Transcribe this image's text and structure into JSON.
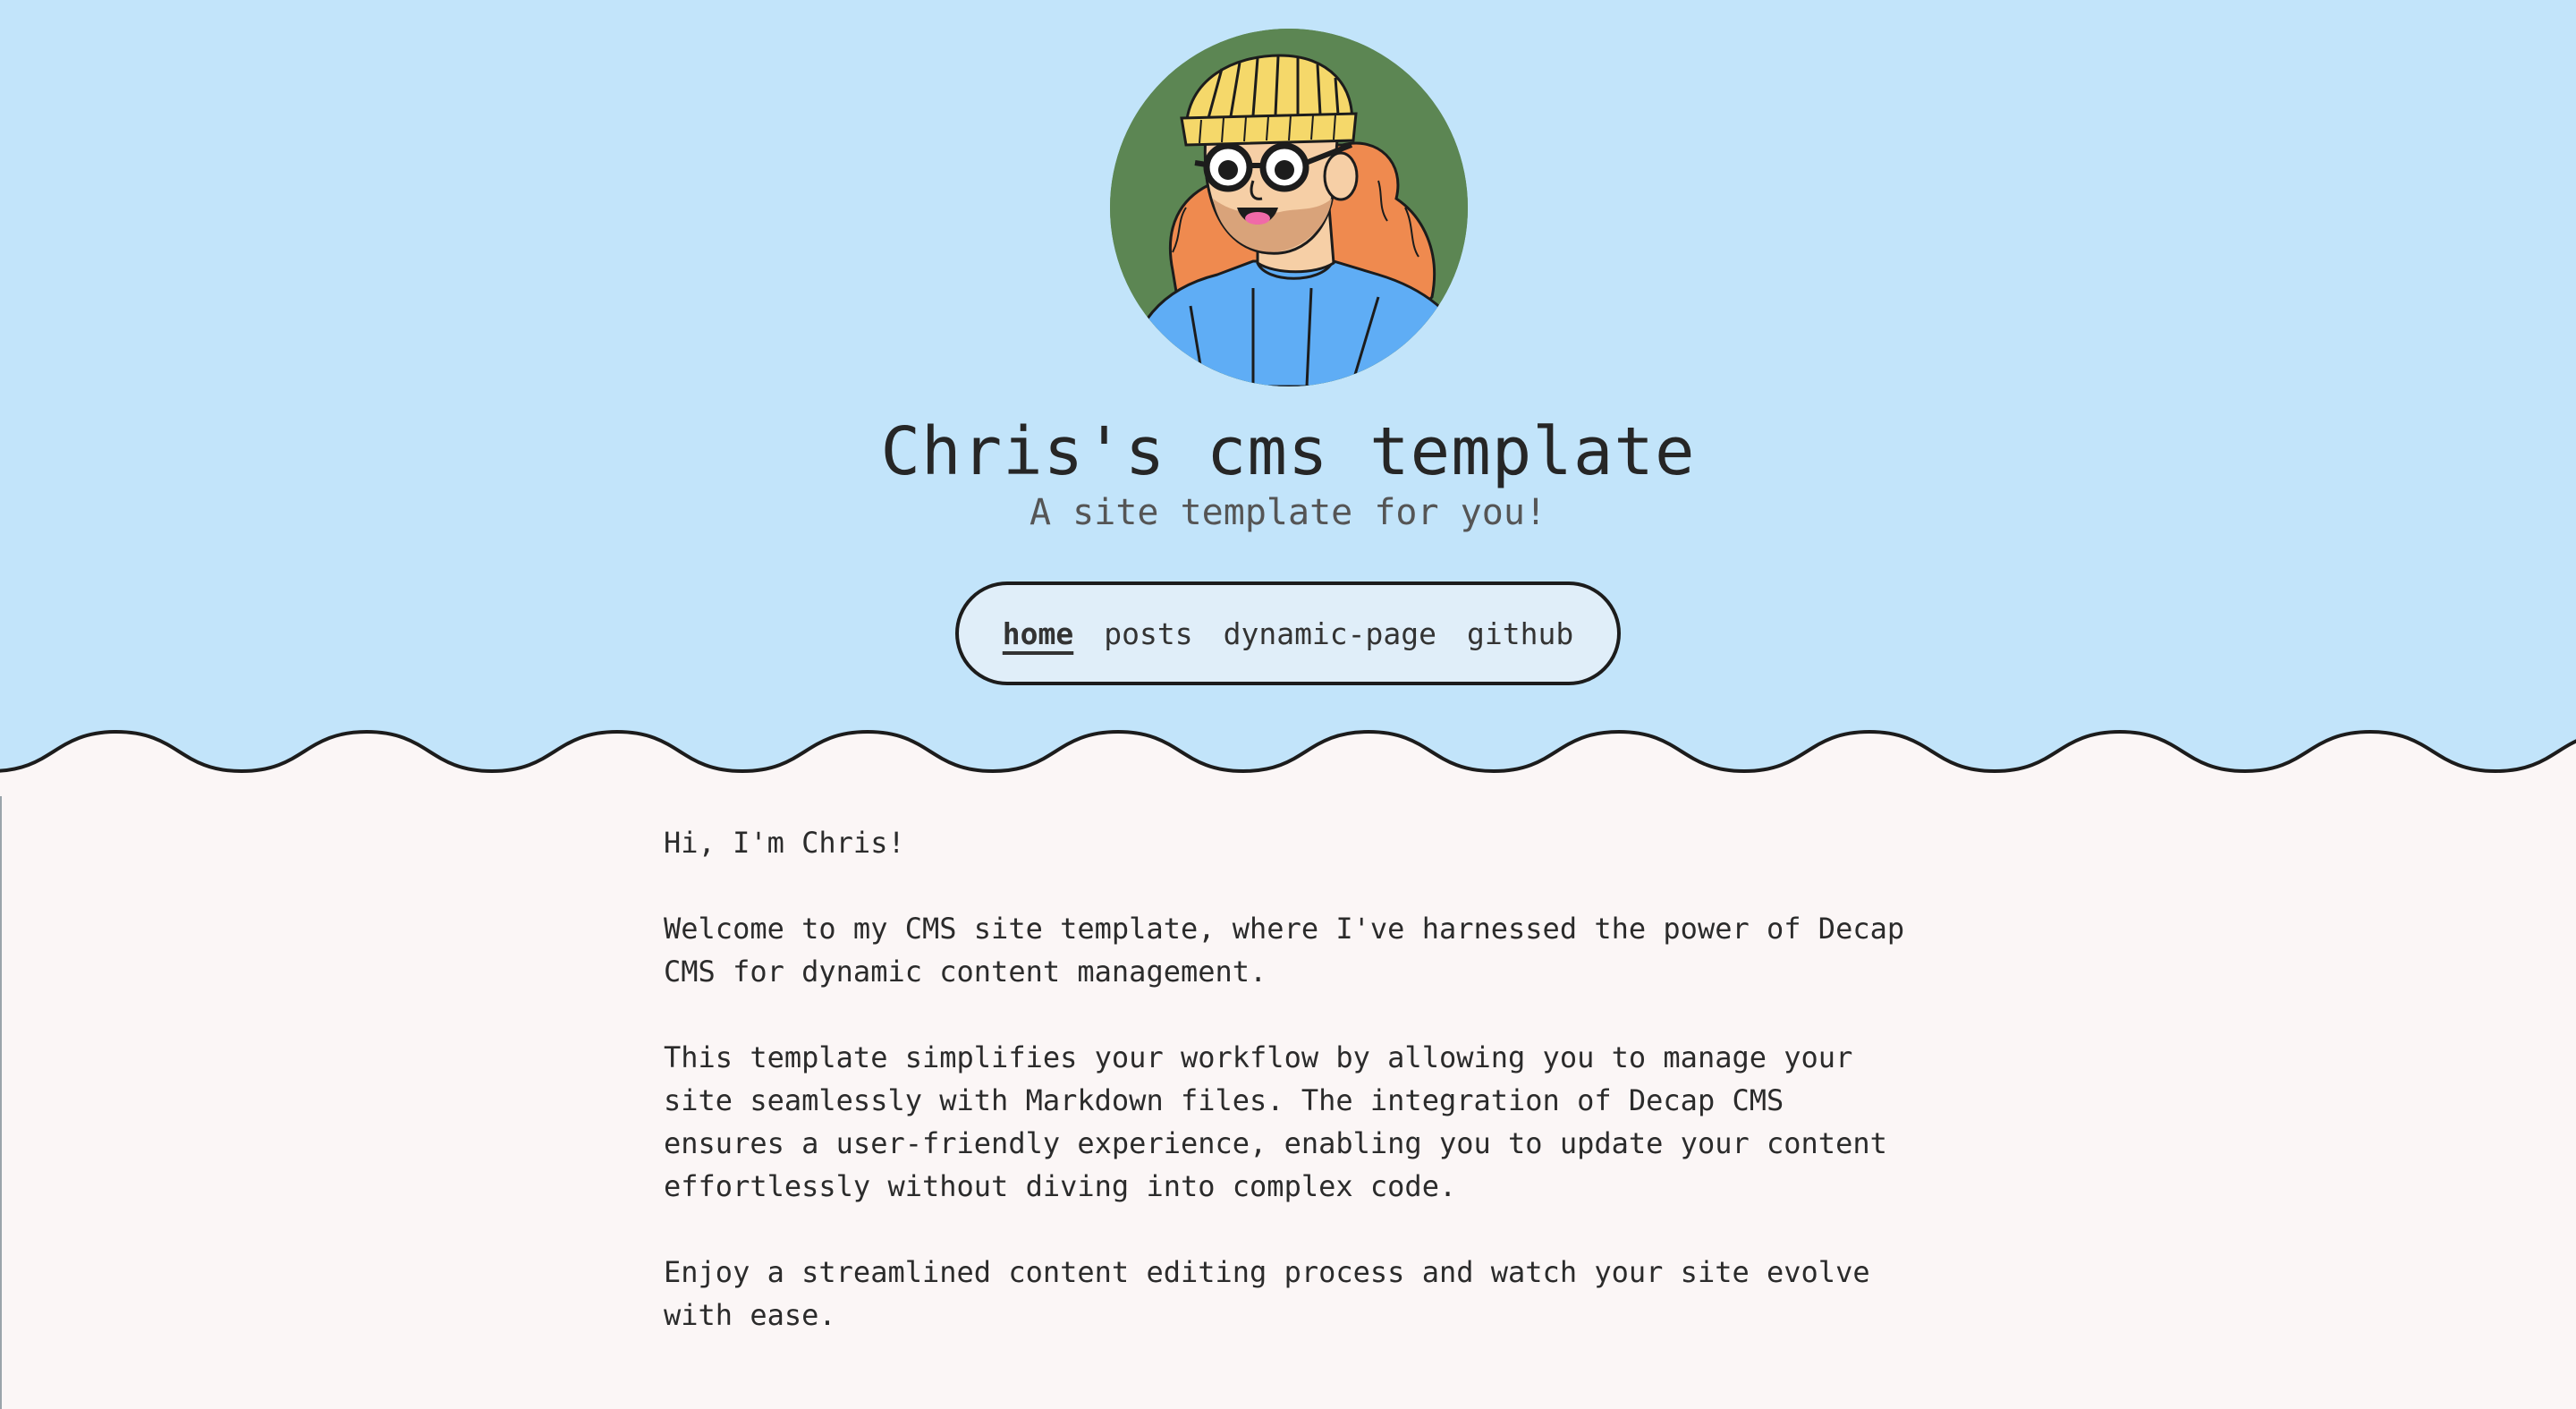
{
  "header": {
    "site_title": "Chris's cms template",
    "site_subtitle": "A site template for you!"
  },
  "avatar": {
    "icon": "avatar-illustration",
    "background": "#5c8653"
  },
  "nav": {
    "items": [
      {
        "label": "home",
        "active": true
      },
      {
        "label": "posts",
        "active": false
      },
      {
        "label": "dynamic-page",
        "active": false
      },
      {
        "label": "github",
        "active": false
      }
    ]
  },
  "content": {
    "paragraphs": [
      "Hi, I'm Chris!",
      "Welcome to my CMS site template, where I've harnessed the power of Decap CMS for dynamic content management.",
      "This template simplifies your workflow by allowing you to manage your site seamlessly with Markdown files. The integration of Decap CMS ensures a user-friendly experience, enabling you to update your content effortlessly without diving into complex code.",
      "Enjoy a streamlined content editing process and watch your site evolve with ease."
    ]
  },
  "colors": {
    "hero_background": "#c2e4fa",
    "page_background": "#fbf6f6",
    "nav_background": "#e0eef9",
    "text": "#2b2b2b"
  }
}
